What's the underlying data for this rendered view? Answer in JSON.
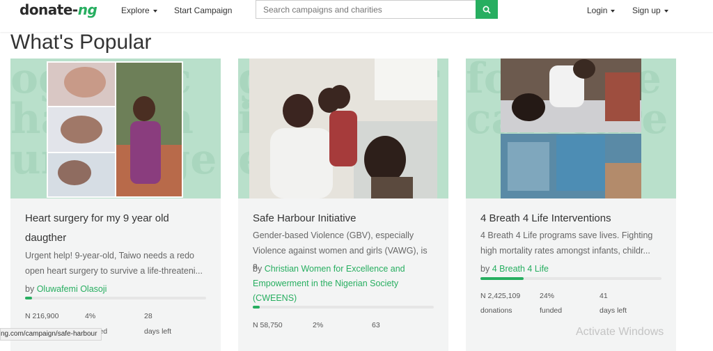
{
  "header": {
    "logo_main": "donate-",
    "logo_accent": "ng",
    "explore_label": "Explore",
    "start_campaign_label": "Start Campaign",
    "search_placeholder": "Search campaigns and charities",
    "login_label": "Login",
    "signup_label": "Sign up"
  },
  "page_title": "What's Popular",
  "cards": [
    {
      "title_line1": "Heart surgery for my 9 year old",
      "title_line2": "daugther",
      "desc_line1": "Urgent help! 9-year-old, Taiwo needs a redo",
      "desc_line2": "open heart surgery to survive a life-threateni...",
      "by_prefix": "by",
      "organizer": "Oluwafemi Olasoji",
      "progress_percent": 4,
      "amount": "N 216,900",
      "funded": "4%",
      "days": "28",
      "amount_label": "donations",
      "funded_label": "funded",
      "days_label": "days left"
    },
    {
      "title_line1": "Safe Harbour Initiative",
      "desc_line1": "Gender-based Violence (GBV), especially",
      "desc_line2": "Violence against women and girls (VAWG), is a",
      "by_prefix": "by",
      "organizer_line1": "Christian Women for Excellence and",
      "organizer_line2": "Empowerment in the Nigerian Society",
      "organizer_line3": "(CWEENS)",
      "progress_percent": 2,
      "amount": "N 58,750",
      "funded": "2%",
      "days": "63"
    },
    {
      "title_line1": "4 Breath 4 Life Interventions",
      "desc_line1": "4 Breath 4 Life programs save lives. Fighting",
      "desc_line2": "high mortality rates amongst infants, childr...",
      "by_prefix": "by",
      "organizer": "4 Breath 4 Life",
      "progress_percent": 24,
      "amount": "N 2,425,109",
      "funded": "24%",
      "days": "41",
      "amount_label": "donations",
      "funded_label": "funded",
      "days_label": "days left"
    }
  ],
  "status_url": "ng.com/campaign/safe-harbour",
  "watermark": "Activate Windows"
}
